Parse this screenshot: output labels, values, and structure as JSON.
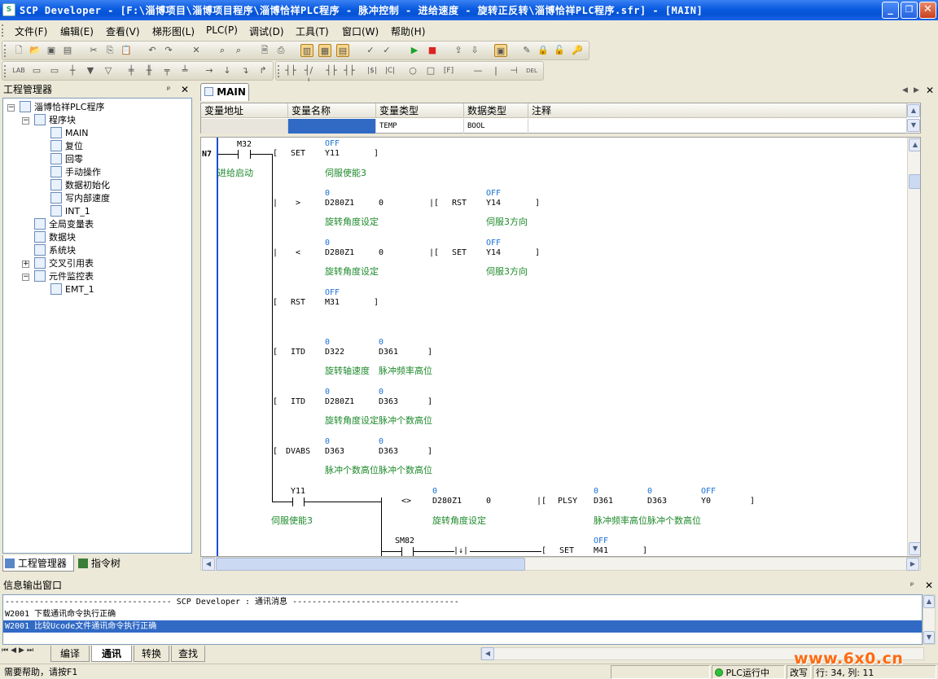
{
  "window": {
    "title": "SCP Developer - [F:\\淄博项目\\淄博项目程序\\淄博恰祥PLC程序 - 脉冲控制 - 进给速度 - 旋转正反转\\淄博恰祥PLC程序.sfr] - [MAIN]",
    "icon": "app-icon",
    "min": "_",
    "max": "❐",
    "close": "✕"
  },
  "menu": [
    "文件(F)",
    "编辑(E)",
    "查看(V)",
    "梯形图(L)",
    "PLC(P)",
    "调试(D)",
    "工具(T)",
    "窗口(W)",
    "帮助(H)"
  ],
  "project_panel": {
    "title": "工程管理器",
    "pin": "ᵖ",
    "close": "✕",
    "tree": [
      {
        "label": "淄博恰祥PLC程序",
        "level": 0,
        "expander": "-"
      },
      {
        "label": "程序块",
        "level": 1,
        "expander": "-"
      },
      {
        "label": "MAIN",
        "level": 2
      },
      {
        "label": "复位",
        "level": 2
      },
      {
        "label": "回零",
        "level": 2
      },
      {
        "label": "手动操作",
        "level": 2
      },
      {
        "label": "数据初始化",
        "level": 2
      },
      {
        "label": "写内部速度",
        "level": 2
      },
      {
        "label": "INT_1",
        "level": 2
      },
      {
        "label": "全局变量表",
        "level": 1
      },
      {
        "label": "数据块",
        "level": 1
      },
      {
        "label": "系统块",
        "level": 1
      },
      {
        "label": "交叉引用表",
        "level": 1,
        "expander": "+"
      },
      {
        "label": "元件监控表",
        "level": 1,
        "expander": "-"
      },
      {
        "label": "EMT_1",
        "level": 2
      }
    ],
    "tabs": [
      "工程管理器",
      "指令树"
    ]
  },
  "editor": {
    "tab": "MAIN",
    "var_table": {
      "headers": [
        "变量地址",
        "变量名称",
        "变量类型",
        "数据类型",
        "注释"
      ],
      "row": [
        "",
        "",
        "TEMP",
        "BOOL",
        ""
      ]
    },
    "network": "N7",
    "ladder": {
      "m32": "M32",
      "set": "SET",
      "y11": "Y11",
      "off": "OFF",
      "cmt_start": "进给启动",
      "cmt_servo3": "伺服使能3",
      "gt": ">",
      "lt": "<",
      "d280z1": "D280Z1",
      "zero": "0",
      "rst": "RST",
      "y14": "Y14",
      "cmt_angle": "旋转角度设定",
      "cmt_dir": "伺服3方向",
      "m31": "M31",
      "itd": "ITD",
      "d322": "D322",
      "d361": "D361",
      "d363": "D363",
      "cmt_axis_speed": "旋转轴速度",
      "cmt_pulse_freq": "脉冲频率高位",
      "cmt_pulse_cnt": "脉冲个数高位",
      "dvabs": "DVABS",
      "ne": "<>",
      "plsy": "PLSY",
      "y0": "Y0",
      "sm82": "SM82",
      "m41": "M41"
    }
  },
  "output": {
    "title": "信息输出窗口",
    "lines": [
      "----------------------------------  SCP Developer : 通讯消息  ----------------------------------",
      "W2001  下载通讯命令执行正确",
      "W2001  比较Ucode文件通讯命令执行正确"
    ],
    "tabs": [
      "编译",
      "通讯",
      "转换",
      "查找"
    ]
  },
  "status": {
    "help": "需要帮助，请按F1",
    "plc": "PLC运行中",
    "mode": "改写",
    "pos": "行: 34, 列: 11",
    "watermark": "www.6x0.cn"
  }
}
